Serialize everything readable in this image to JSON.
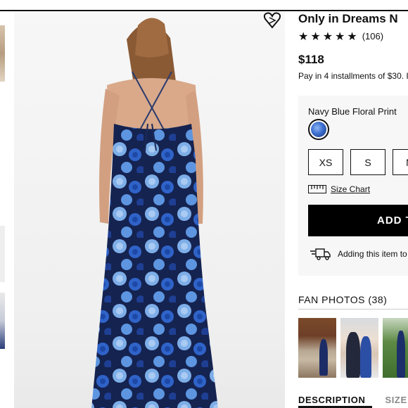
{
  "product": {
    "title": "Only in Dreams N",
    "rating_stars": "★★★★★",
    "review_count": "(106)",
    "price": "$118",
    "installments": "Pay in 4 installments of $30. I"
  },
  "options": {
    "color_label": "Navy Blue Floral Print",
    "sizes": [
      "XS",
      "S",
      "M"
    ],
    "size_chart_label": "Size Chart",
    "add_button_label": "ADD T",
    "shipping_note": "Adding this item to"
  },
  "fan_photos": {
    "title": "FAN PHOTOS (38)"
  },
  "tabs": [
    "DESCRIPTION",
    "SIZE"
  ],
  "icons": {
    "wishlist": "heart-icon",
    "color_swatch": "floral-swatch-icon",
    "size_chart": "ruler-icon",
    "shipping": "truck-icon"
  },
  "colors": {
    "accent": "#000000",
    "dress_navy": "#16254f",
    "dress_blue": "#2f63c9",
    "dress_light_blue": "#7eaee8"
  }
}
